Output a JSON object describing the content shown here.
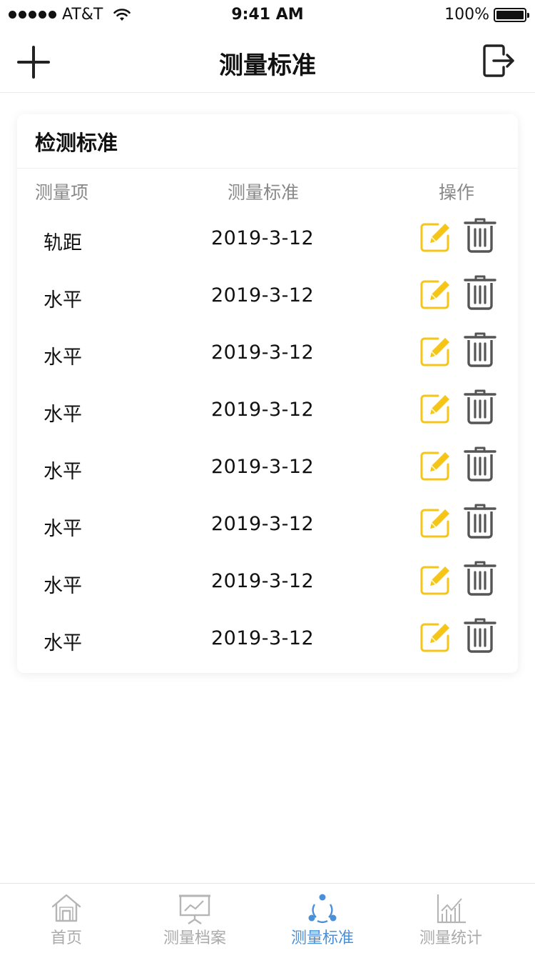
{
  "status_bar": {
    "carrier": "AT&T",
    "time": "9:41 AM",
    "battery": "100%"
  },
  "nav": {
    "title": "测量标准",
    "add_icon": "plus-icon",
    "exit_icon": "exit-icon"
  },
  "card": {
    "title": "检测标准",
    "columns": {
      "item": "测量项",
      "standard": "测量标准",
      "action": "操作"
    },
    "rows": [
      {
        "item": "轨距",
        "date": "2019-3-12"
      },
      {
        "item": "水平",
        "date": "2019-3-12"
      },
      {
        "item": "水平",
        "date": "2019-3-12"
      },
      {
        "item": "水平",
        "date": "2019-3-12"
      },
      {
        "item": "水平",
        "date": "2019-3-12"
      },
      {
        "item": "水平",
        "date": "2019-3-12"
      },
      {
        "item": "水平",
        "date": "2019-3-12"
      },
      {
        "item": "水平",
        "date": "2019-3-12"
      }
    ]
  },
  "tab_bar": {
    "tabs": [
      {
        "label": "首页",
        "icon": "home-icon",
        "active": false
      },
      {
        "label": "测量档案",
        "icon": "presentation-board-icon",
        "active": false
      },
      {
        "label": "测量标准",
        "icon": "share-nodes-icon",
        "active": true
      },
      {
        "label": "测量统计",
        "icon": "line-chart-icon",
        "active": false
      }
    ]
  },
  "colors": {
    "accent": "#4a90d9",
    "edit": "#f5c518",
    "delete": "#555555",
    "inactive_tab": "#aaaaaa"
  }
}
